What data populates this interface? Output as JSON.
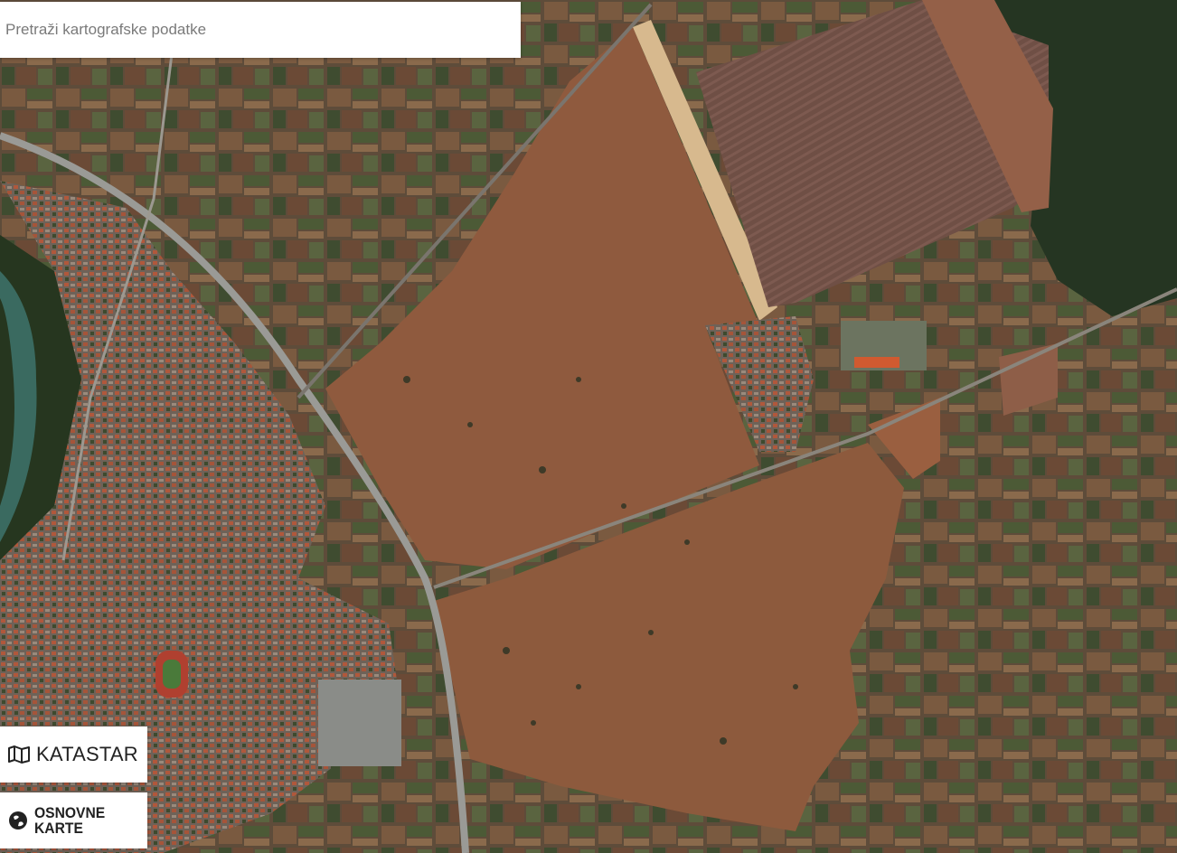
{
  "search": {
    "placeholder": "Pretraži kartografske podatke"
  },
  "buttons": {
    "katastar": {
      "label": "KATASTAR",
      "icon": "map-icon"
    },
    "osnovne": {
      "line1": "OSNOVNE",
      "line2": "KARTE",
      "icon": "globe-icon"
    }
  },
  "map": {
    "layer": "satellite"
  }
}
